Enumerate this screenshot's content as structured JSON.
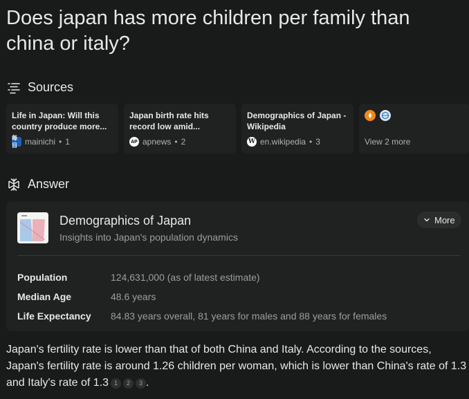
{
  "question": "Does japan has more children per family than china or italy?",
  "sources": {
    "heading": "Sources",
    "icon": "sources-icon",
    "items": [
      {
        "title": "Life in Japan: Will this country produce more...",
        "site": "mainichi",
        "index": "1",
        "favicon": "mainichi-favicon",
        "favicon_text": "毎日"
      },
      {
        "title": "Japan birth rate hits record low amid...",
        "site": "apnews",
        "index": "2",
        "favicon": "ap-favicon",
        "favicon_text": "AP"
      },
      {
        "title": "Demographics of Japan - Wikipedia",
        "site": "en.wikipedia",
        "index": "3",
        "favicon": "wikipedia-favicon",
        "favicon_text": "W"
      }
    ],
    "view_more": "View 2 more"
  },
  "answer": {
    "heading": "Answer",
    "icon": "answer-icon",
    "card": {
      "title": "Demographics of Japan",
      "subtitle": "Insights into Japan's population dynamics",
      "more_label": "More",
      "facts": [
        {
          "label": "Population",
          "value": "124,631,000 (as of latest estimate)"
        },
        {
          "label": "Median Age",
          "value": "48.6 years"
        },
        {
          "label": "Life Expectancy",
          "value": "84.83 years overall, 81 years for males and 88 years for females"
        }
      ]
    },
    "text": "Japan's fertility rate is lower than that of both China and Italy. According to the sources, Japan's fertility rate is around 1.26 children per woman, which is lower than China's rate of 1.3 and Italy's rate of 1.3",
    "citations": [
      "1",
      "2",
      "3"
    ],
    "end": "."
  },
  "colors": {
    "background": "#191a1a",
    "card": "#202222",
    "text": "#e8e8e6",
    "muted": "#9c9d9b"
  }
}
